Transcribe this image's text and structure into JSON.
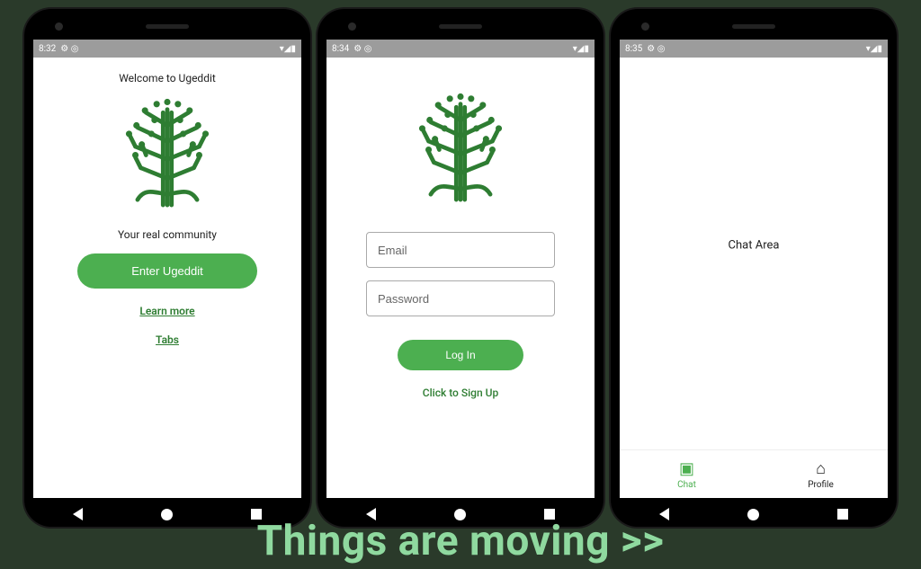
{
  "caption": "Things are moving >>",
  "phone1": {
    "status": {
      "time": "8:32",
      "icons": "⚙ ◎",
      "right": "▾◢▮"
    },
    "welcome": "Welcome to Ugeddit",
    "subtitle": "Your real community",
    "primary_btn": "Enter Ugeddit",
    "link1": "Learn more",
    "link2": "Tabs"
  },
  "phone2": {
    "status": {
      "time": "8:34",
      "icons": "⚙ ◎",
      "right": "▾◢▮"
    },
    "email_placeholder": "Email",
    "password_placeholder": "Password",
    "primary_btn": "Log In",
    "signup_link": "Click to Sign Up"
  },
  "phone3": {
    "status": {
      "time": "8:35",
      "icons": "⚙ ◎",
      "right": "▾◢▮"
    },
    "body_text": "Chat Area",
    "tabs": {
      "chat": "Chat",
      "profile": "Profile"
    }
  }
}
